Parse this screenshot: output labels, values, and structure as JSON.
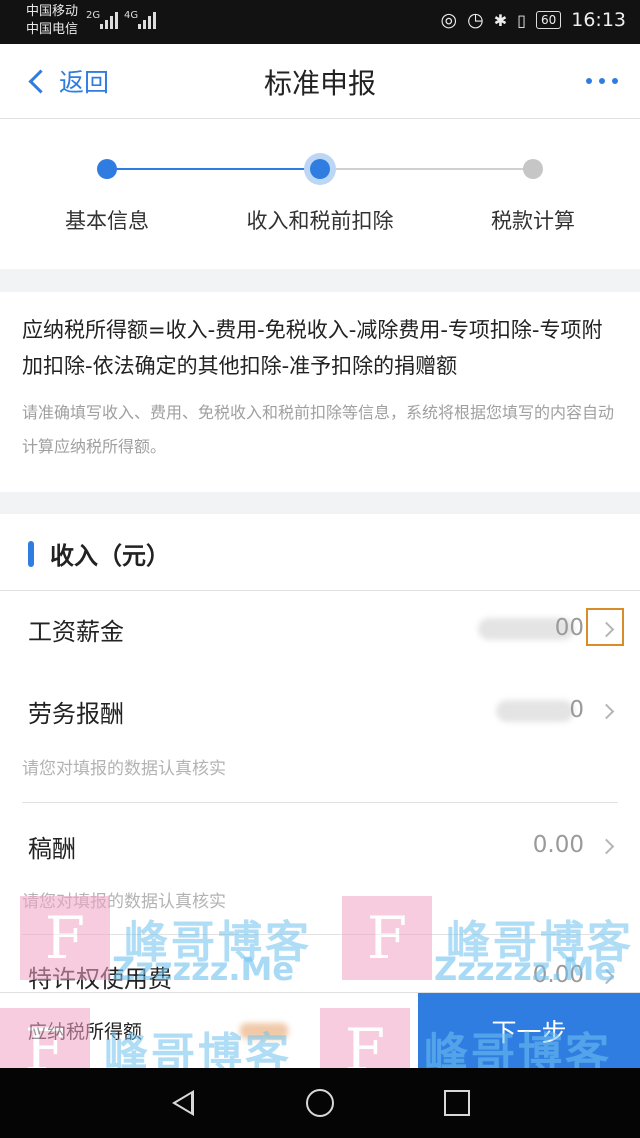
{
  "status_bar": {
    "carrier_1": "中国移动",
    "carrier_2": "中国电信",
    "network_1": "2G",
    "network_2": "4G",
    "battery": "60",
    "time": "16:13"
  },
  "nav": {
    "back_label": "返回",
    "title": "标准申报"
  },
  "steps": [
    {
      "label": "基本信息",
      "state": "done"
    },
    {
      "label": "收入和税前扣除",
      "state": "current"
    },
    {
      "label": "税款计算",
      "state": "pending"
    }
  ],
  "formula": {
    "text": "应纳税所得额=收入-费用-免税收入-减除费用-专项扣除-专项附加扣除-依法确定的其他扣除-准予扣除的捐赠额",
    "hint": "请准确填写收入、费用、免税收入和税前扣除等信息，系统将根据您填写的内容自动计算应纳税所得额。"
  },
  "income": {
    "title": "收入（元）",
    "rows": [
      {
        "label": "工资薪金",
        "value": "00",
        "hint": ""
      },
      {
        "label": "劳务报酬",
        "value": "0",
        "hint": "请您对填报的数据认真核实"
      },
      {
        "label": "稿酬",
        "value": "0.00",
        "hint": "请您对填报的数据认真核实"
      },
      {
        "label": "特许权使用费",
        "value": "0.00",
        "hint": ""
      }
    ]
  },
  "bottom": {
    "total_label": "应纳税所得额",
    "next_label": "下一步"
  },
  "watermark": {
    "logo": "F",
    "text": "峰哥博客",
    "domain": "Zzzzzz.Me"
  },
  "colors": {
    "accent": "#2f7de1",
    "highlight": "#d98c2a"
  }
}
